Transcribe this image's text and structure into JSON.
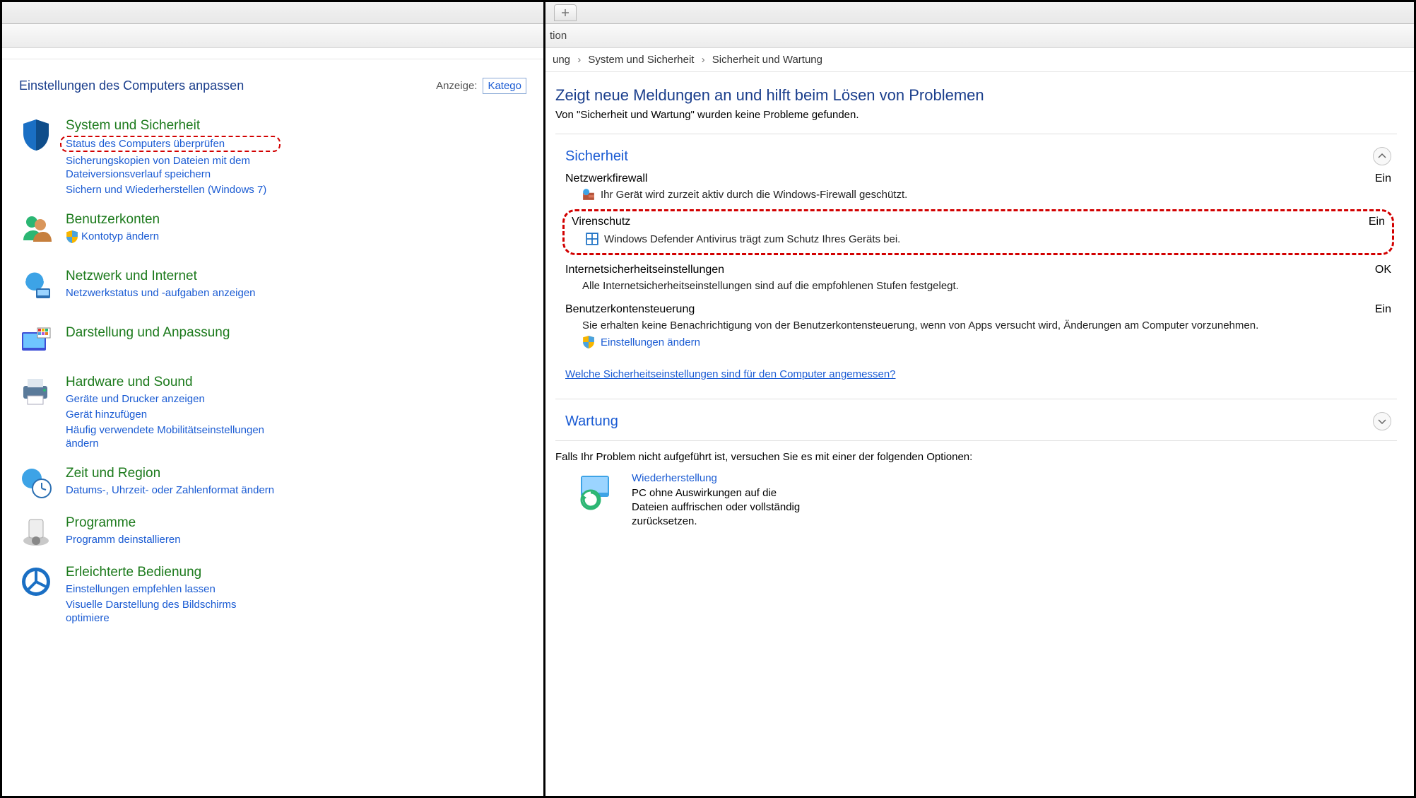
{
  "left": {
    "title": "Einstellungen des Computers anpassen",
    "view_label": "Anzeige:",
    "view_value": "Katego",
    "cats": [
      {
        "heading": "System und Sicherheit",
        "links": [
          "Status des Computers überprüfen",
          "Sicherungskopien von Dateien mit dem Dateiversionsverlauf speichern",
          "Sichern und Wiederherstellen (Windows 7)"
        ]
      },
      {
        "heading": "Benutzerkonten",
        "links": [
          "Kontotyp ändern"
        ]
      },
      {
        "heading": "Netzwerk und Internet",
        "links": [
          "Netzwerkstatus und -aufgaben anzeigen"
        ]
      },
      {
        "heading": "Darstellung und Anpassung",
        "links": []
      },
      {
        "heading": "Hardware und Sound",
        "links": [
          "Geräte und Drucker anzeigen",
          "Gerät hinzufügen",
          "Häufig verwendete Mobilitätseinstellungen ändern"
        ]
      },
      {
        "heading": "Zeit und Region",
        "links": [
          "Datums-, Uhrzeit- oder Zahlenformat ändern"
        ]
      },
      {
        "heading": "Programme",
        "links": [
          "Programm deinstallieren"
        ]
      },
      {
        "heading": "Erleichterte Bedienung",
        "links": [
          "Einstellungen empfehlen lassen",
          "Visuelle Darstellung des Bildschirms optimiere"
        ]
      }
    ]
  },
  "right": {
    "toolbar_frag": "tion",
    "crumbs": [
      "ung",
      "System und Sicherheit",
      "Sicherheit und Wartung"
    ],
    "h1": "Zeigt neue Meldungen an und hilft beim Lösen von Problemen",
    "sub": "Von \"Sicherheit und Wartung\" wurden keine Probleme gefunden.",
    "sec_security": "Sicherheit",
    "items": {
      "firewall": {
        "name": "Netzwerkfirewall",
        "state": "Ein",
        "desc": "Ihr Gerät wird zurzeit aktiv durch die Windows-Firewall geschützt."
      },
      "virus": {
        "name": "Virenschutz",
        "state": "Ein",
        "desc": "Windows Defender Antivirus trägt zum Schutz Ihres Geräts bei."
      },
      "inet": {
        "name": "Internetsicherheitseinstellungen",
        "state": "OK",
        "desc": "Alle Internetsicherheitseinstellungen sind auf die empfohlenen Stufen festgelegt."
      },
      "uac": {
        "name": "Benutzerkontensteuerung",
        "state": "Ein",
        "desc": "Sie erhalten keine Benachrichtigung von der Benutzerkontensteuerung, wenn von Apps versucht wird, Änderungen am Computer vorzunehmen.",
        "link": "Einstellungen ändern"
      }
    },
    "sec_link": "Welche Sicherheitseinstellungen sind für den Computer angemessen?",
    "sec_maint": "Wartung",
    "alt_text": "Falls Ihr Problem nicht aufgeführt ist, versuchen Sie es mit einer der folgenden Optionen:",
    "recovery": {
      "title": "Wiederherstellung",
      "desc": "PC ohne Auswirkungen auf die Dateien auffrischen oder vollständig zurücksetzen."
    }
  }
}
